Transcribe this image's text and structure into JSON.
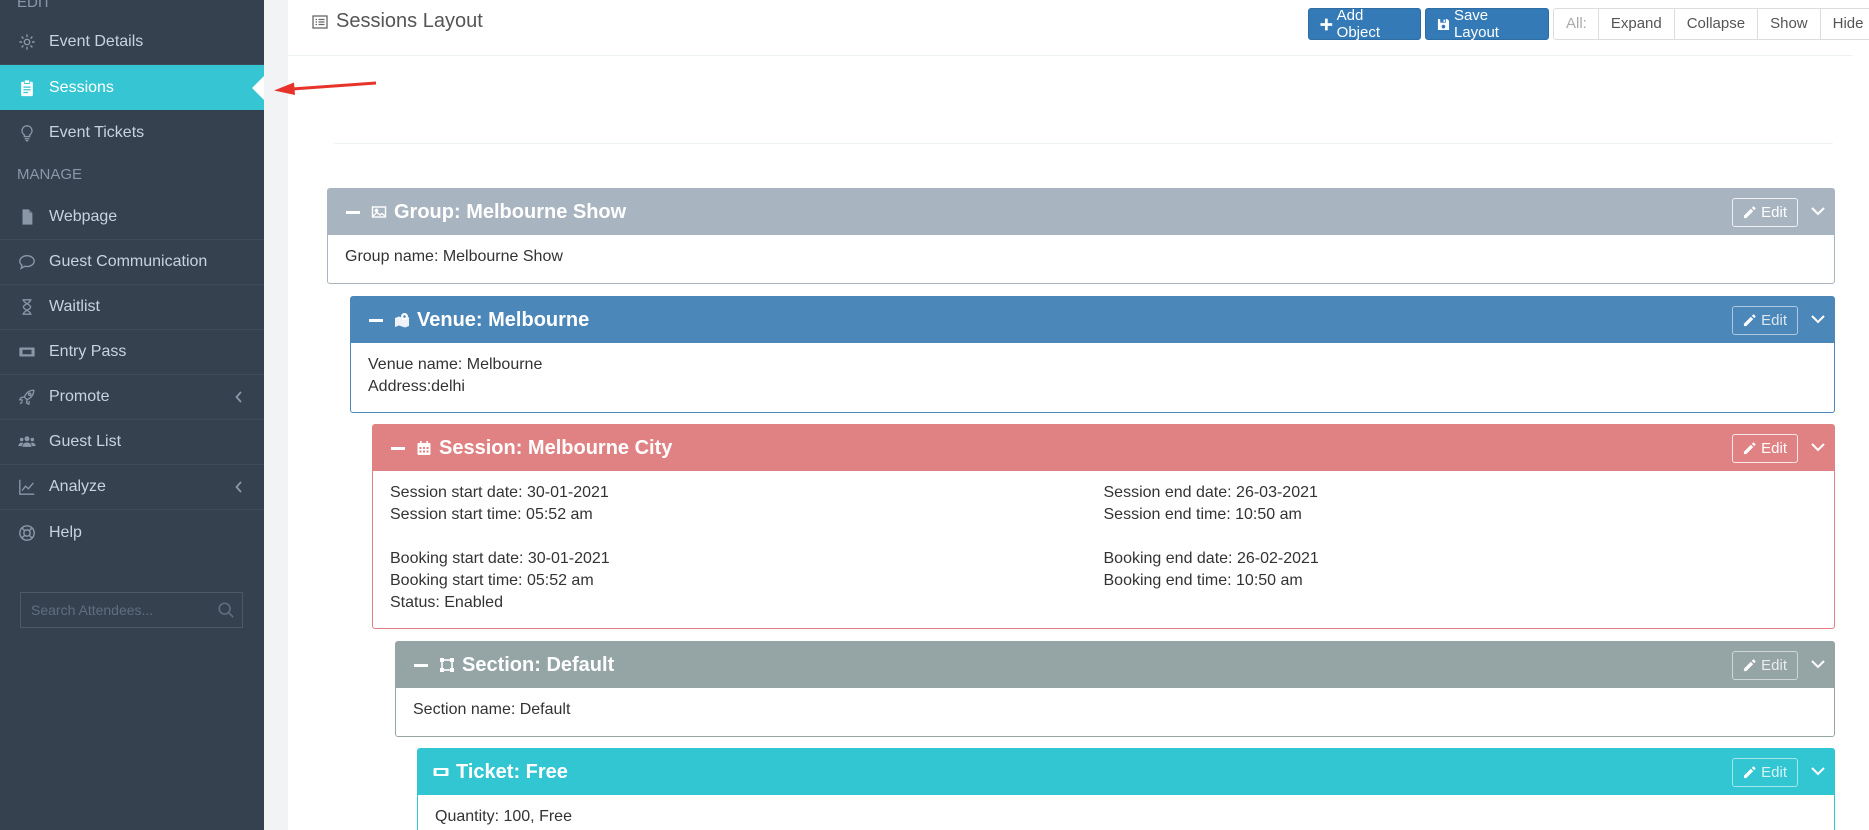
{
  "sidebar": {
    "section_edit": "EDIT",
    "section_manage": "MANAGE",
    "items": [
      {
        "label": "Event Details",
        "icon": "gear-icon"
      },
      {
        "label": "Sessions",
        "icon": "clipboard-icon",
        "active": true
      },
      {
        "label": "Event Tickets",
        "icon": "lightbulb-icon"
      },
      {
        "label": "Webpage",
        "icon": "file-icon"
      },
      {
        "label": "Guest Communication",
        "icon": "comment-icon"
      },
      {
        "label": "Waitlist",
        "icon": "hourglass-icon"
      },
      {
        "label": "Entry Pass",
        "icon": "ticket-icon"
      },
      {
        "label": "Promote",
        "icon": "rocket-icon"
      },
      {
        "label": "Guest List",
        "icon": "users-icon"
      },
      {
        "label": "Analyze",
        "icon": "chart-icon"
      },
      {
        "label": "Help",
        "icon": "lifebuoy-icon"
      }
    ],
    "search_placeholder": "Search Attendees..."
  },
  "header": {
    "title": "Sessions Layout",
    "add_object": "Add Object",
    "save_layout": "Save Layout",
    "all_label": "All:",
    "expand": "Expand",
    "collapse": "Collapse",
    "show": "Show",
    "hide": "Hide"
  },
  "panels": {
    "edit_label": "Edit",
    "group": {
      "title": "Group: Melbourne Show",
      "name_line": "Group name: Melbourne Show"
    },
    "venue": {
      "title": "Venue: Melbourne",
      "name_line": "Venue name: Melbourne",
      "address_line": "Address:delhi"
    },
    "session": {
      "title": "Session: Melbourne City",
      "start_date": "Session start date: 30-01-2021",
      "start_time": "Session start time: 05:52 am",
      "end_date": "Session end date: 26-03-2021",
      "end_time": "Session end time: 10:50 am",
      "booking_start_date": "Booking start date: 30-01-2021",
      "booking_start_time": "Booking start time: 05:52 am",
      "status": "Status: Enabled",
      "booking_end_date": "Booking end date: 26-02-2021",
      "booking_end_time": "Booking end time: 10:50 am"
    },
    "section": {
      "title": "Section: Default",
      "name_line": "Section name: Default"
    },
    "ticket": {
      "title": "Ticket: Free",
      "quantity_line": "Quantity: 100, Free"
    }
  },
  "colors": {
    "sidebar_bg": "#364150",
    "active_item": "#36c6d3",
    "primary_button": "#337ab7",
    "group_header": "#a9b4c1",
    "venue_header": "#4c87b9",
    "session_header": "#e08283",
    "section_header": "#95a5a6",
    "ticket_header": "#32c5d2",
    "annotation_arrow": "#e7342b"
  }
}
